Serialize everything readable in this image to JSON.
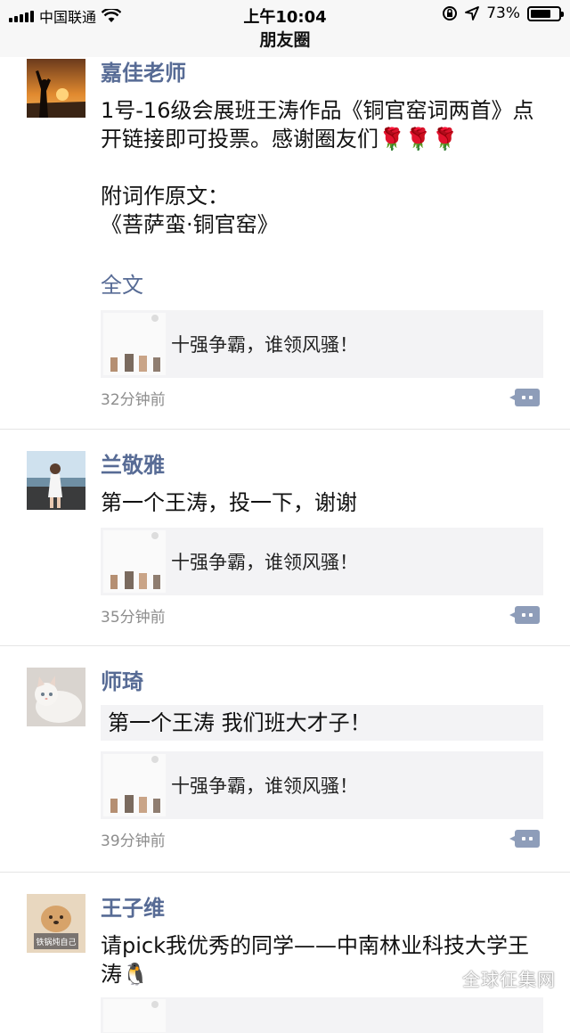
{
  "status_bar": {
    "carrier": "中国联通",
    "time": "上午10:04",
    "battery": "73%",
    "battery_level": 0.73
  },
  "nav": {
    "title": "朋友圈"
  },
  "posts": [
    {
      "name": "嘉佳老师",
      "text": "1号-16级会展班王涛作品《铜官窑词两首》点开链接即可投票。感谢圈友们🌹🌹🌹\n\n附词作原文：\n《菩萨蛮·铜官窑》",
      "full_text": "全文",
      "link_title": "十强争霸，谁领风骚！",
      "time": "32分钟前"
    },
    {
      "name": "兰敬雅",
      "text": "第一个王涛，投一下，谢谢",
      "link_title": "十强争霸，谁领风骚！",
      "time": "35分钟前"
    },
    {
      "name": "师琦",
      "quote": "第一个王涛 我们班大才子！",
      "link_title": "十强争霸，谁领风骚！",
      "time": "39分钟前"
    },
    {
      "name": "王子维",
      "avatar_caption": "铁锅炖自己",
      "text": "请pick我优秀的同学——中南林业科技大学王涛🐧"
    }
  ],
  "watermark": "全球征集网"
}
